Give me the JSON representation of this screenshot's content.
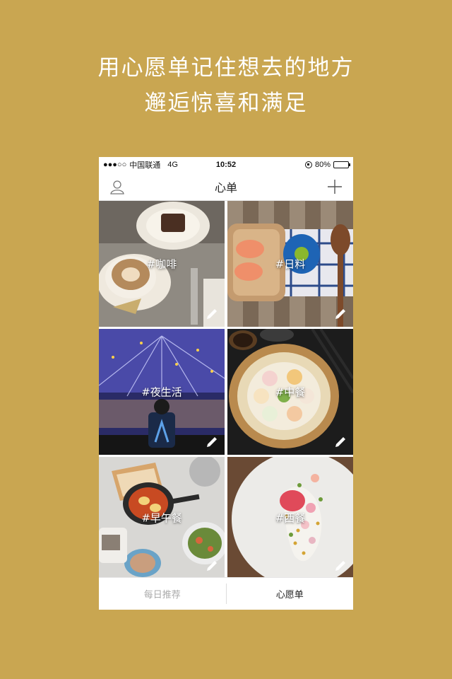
{
  "promo": {
    "line1": "用心愿单记住想去的地方",
    "line2": "邂逅惊喜和满足"
  },
  "status_bar": {
    "signal": "●●●○○",
    "carrier": "中国联通",
    "network": "4G",
    "time": "10:52",
    "battery": "80%",
    "battery_level": 0.8
  },
  "nav": {
    "title": "心单",
    "left_icon": "profile-icon",
    "right_icon": "plus-icon"
  },
  "tiles": [
    {
      "label": "#咖啡"
    },
    {
      "label": "#日料"
    },
    {
      "label": "#夜生活"
    },
    {
      "label": "#中餐"
    },
    {
      "label": "#早午餐"
    },
    {
      "label": "#西餐"
    }
  ],
  "tabs": {
    "daily": "每日推荐",
    "wishlist": "心愿单"
  },
  "colors": {
    "background": "#c9a651",
    "active_tab": "#222222",
    "inactive_tab": "#aaaaaa"
  }
}
